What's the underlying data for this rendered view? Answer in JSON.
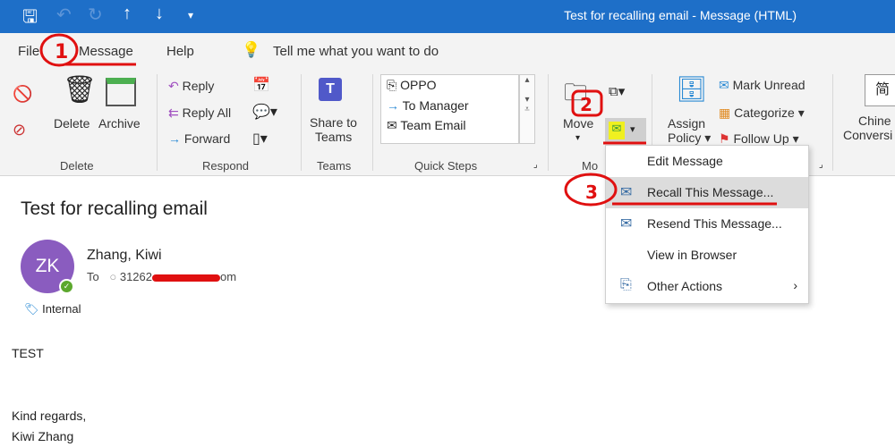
{
  "titlebar": {
    "title": "Test for recalling email  -  Message (HTML)",
    "quick_access": [
      "save-icon",
      "undo-icon",
      "redo-icon",
      "arrow-up-icon",
      "arrow-down-icon",
      "customize-icon"
    ]
  },
  "tabs": [
    {
      "label": "File"
    },
    {
      "label": "Message",
      "active": true
    },
    {
      "label": "Help"
    }
  ],
  "tell_me": "Tell me what you want to do",
  "ribbon": {
    "delete_group": {
      "label": "Delete",
      "delete": "Delete",
      "archive": "Archive"
    },
    "respond_group": {
      "label": "Respond",
      "reply": "Reply",
      "reply_all": "Reply All",
      "forward": "Forward"
    },
    "teams_group": {
      "label": "Teams",
      "share": "Share to",
      "share2": "Teams"
    },
    "quick_steps": {
      "label": "Quick Steps",
      "items": [
        "OPPO",
        "To Manager",
        "Team Email"
      ]
    },
    "move_group": {
      "label": "Mo",
      "move": "Move"
    },
    "tags_group": {
      "assign": "Assign",
      "assign2": "Policy",
      "mark_unread": "Mark Unread",
      "categorize": "Categorize",
      "follow_up": "Follow Up"
    },
    "chinese": {
      "line1": "Chine",
      "line2": "Conversi"
    }
  },
  "menu": {
    "items": [
      {
        "label": "Edit Message"
      },
      {
        "label": "Recall This Message...",
        "highlighted": true
      },
      {
        "label": "Resend This Message..."
      },
      {
        "label": "View in Browser"
      },
      {
        "label": "Other Actions"
      }
    ]
  },
  "message": {
    "subject": "Test for recalling email",
    "avatar_initials": "ZK",
    "avatar_color": "#8a5cbf",
    "sender": "Zhang, Kiwi",
    "to_label": "To",
    "to_value": "31262",
    "to_suffix": "om",
    "sensitivity": "Internal",
    "body": [
      "TEST",
      "Kind regards,",
      "Kiwi Zhang"
    ]
  },
  "annotations": [
    "1",
    "2",
    "3"
  ],
  "colors": {
    "titlebar": "#1e6fc8",
    "annotation": "#e01010",
    "highlight": "#f0f020"
  }
}
